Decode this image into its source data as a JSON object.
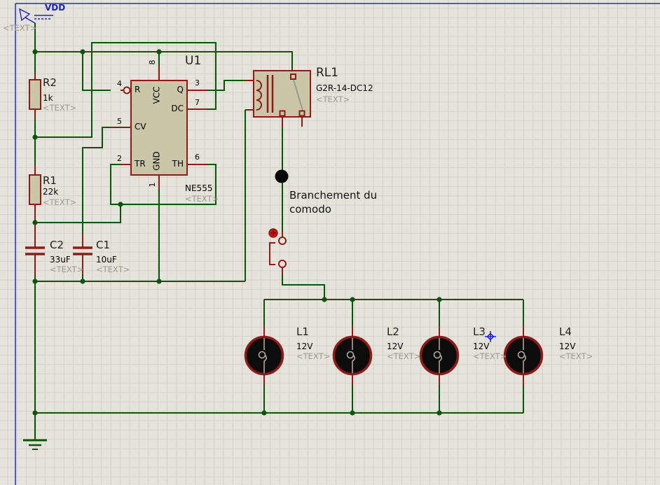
{
  "colors": {
    "wire_green": "#0b520b",
    "component_maroon": "#8e1a1a",
    "body_tan": "#cac6a8",
    "frame_blue": "#2828c8",
    "placeholder_gray": "#9b9b94",
    "lamp_black": "#0c0c0c",
    "marker_red": "#d11212"
  },
  "power": {
    "net": "VDD",
    "text": "<TEXT>"
  },
  "components": {
    "r2": {
      "ref": "R2",
      "value": "1k",
      "text": "<TEXT>"
    },
    "r1": {
      "ref": "R1",
      "value": "22k",
      "text": "<TEXT>"
    },
    "c2": {
      "ref": "C2",
      "value": "33uF",
      "text": "<TEXT>"
    },
    "c1": {
      "ref": "C1",
      "value": "10uF",
      "text": "<TEXT>"
    },
    "u1": {
      "ref": "U1",
      "part": "NE555",
      "text": "<TEXT>",
      "pins": {
        "r": "R",
        "cv": "CV",
        "tr": "TR",
        "q": "Q",
        "dc": "DC",
        "th": "TH",
        "vcc": "VCC",
        "gnd": "GND",
        "n4": "4",
        "n5": "5",
        "n2": "2",
        "n3": "3",
        "n7": "7",
        "n6": "6",
        "n8": "8",
        "n1": "1"
      }
    },
    "rl1": {
      "ref": "RL1",
      "part": "G2R-14-DC12",
      "text": "<TEXT>"
    },
    "lamps": [
      {
        "ref": "L1",
        "value": "12V",
        "text": "<TEXT>"
      },
      {
        "ref": "L2",
        "value": "12V",
        "text": "<TEXT>"
      },
      {
        "ref": "L3",
        "value": "12V",
        "text": "<TEXT>"
      },
      {
        "ref": "L4",
        "value": "12V",
        "text": "<TEXT>"
      }
    ]
  },
  "annotation": {
    "line1": "Branchement du",
    "line2": "comodo"
  }
}
